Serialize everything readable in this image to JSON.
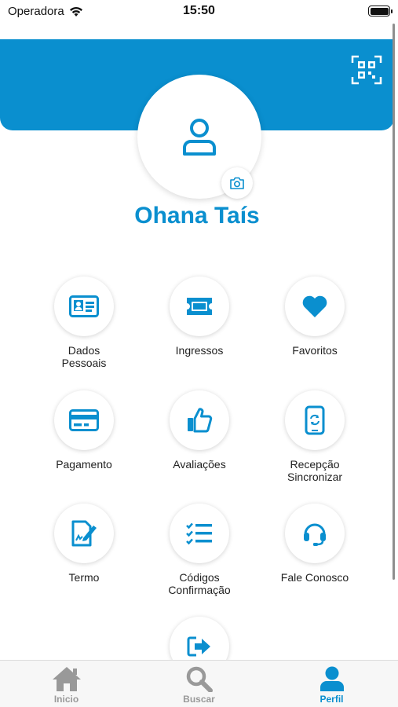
{
  "status_bar": {
    "carrier": "Operadora",
    "time": "15:50"
  },
  "profile": {
    "name": "Ohana Taís"
  },
  "menu": {
    "items": [
      {
        "label_1": "Dados",
        "label_2": "Pessoais",
        "icon": "id-card-icon"
      },
      {
        "label_1": "Ingressos",
        "label_2": "",
        "icon": "ticket-icon"
      },
      {
        "label_1": "Favoritos",
        "label_2": "",
        "icon": "heart-icon"
      },
      {
        "label_1": "Pagamento",
        "label_2": "",
        "icon": "credit-card-icon"
      },
      {
        "label_1": "Avaliações",
        "label_2": "",
        "icon": "thumbs-up-icon"
      },
      {
        "label_1": "Recepção",
        "label_2": "Sincronizar",
        "icon": "phone-sync-icon"
      },
      {
        "label_1": "Termo",
        "label_2": "",
        "icon": "document-sign-icon"
      },
      {
        "label_1": "Códigos",
        "label_2": "Confirmação",
        "icon": "checklist-icon"
      },
      {
        "label_1": "Fale Conosco",
        "label_2": "",
        "icon": "headset-icon"
      },
      {
        "label_1": "",
        "label_2": "",
        "icon": "logout-icon"
      }
    ]
  },
  "tab_bar": {
    "tabs": [
      {
        "label": "Inicio",
        "icon": "home-icon",
        "active": false
      },
      {
        "label": "Buscar",
        "icon": "search-icon",
        "active": false
      },
      {
        "label": "Perfil",
        "icon": "person-icon",
        "active": true
      }
    ]
  },
  "colors": {
    "primary": "#0a8fcf",
    "inactive": "#999999"
  }
}
